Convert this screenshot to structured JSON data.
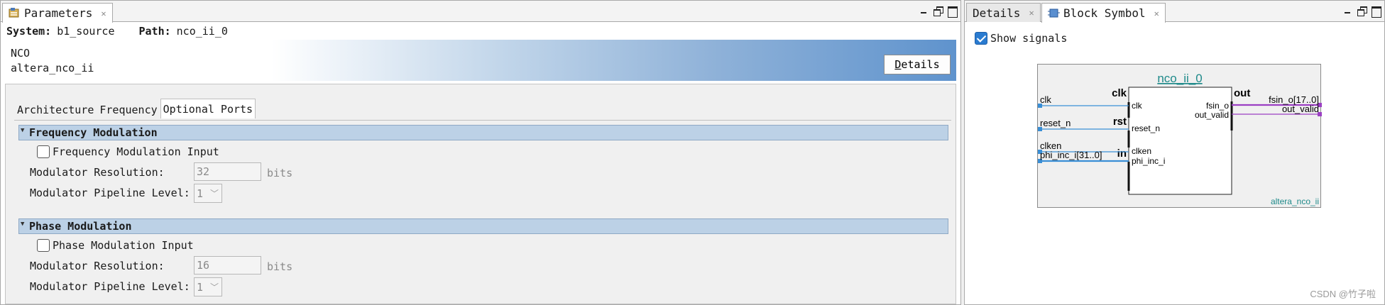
{
  "left_panel": {
    "tab_label": "Parameters",
    "path_bar": {
      "system_label": "System:",
      "system_value": "b1_source",
      "path_label": "Path:",
      "path_value": "nco_ii_0"
    },
    "header": {
      "title": "NCO",
      "subtitle": "altera_nco_ii",
      "details_button": "Details"
    },
    "subtabs": [
      "Architecture",
      "Frequency",
      "Optional Ports"
    ],
    "active_subtab": "Optional Ports",
    "groups": [
      {
        "title": "Frequency Modulation",
        "checkbox_label": "Frequency Modulation Input",
        "resolution_label": "Modulator Resolution:",
        "resolution_value": "32",
        "resolution_unit": "bits",
        "pipeline_label": "Modulator Pipeline Level:",
        "pipeline_value": "1"
      },
      {
        "title": "Phase Modulation",
        "checkbox_label": "Phase Modulation Input",
        "resolution_label": "Modulator Resolution:",
        "resolution_value": "16",
        "resolution_unit": "bits",
        "pipeline_label": "Modulator Pipeline Level:",
        "pipeline_value": "1"
      }
    ]
  },
  "right_panel": {
    "tabs": [
      "Details",
      "Block Symbol"
    ],
    "active_tab": "Block Symbol",
    "show_signals_label": "Show signals",
    "show_signals_checked": true,
    "symbol": {
      "instance_name": "nco_ii_0",
      "component_name": "altera_nco_ii",
      "interfaces": {
        "clk": "clk",
        "rst": "rst",
        "in": "in",
        "out": "out"
      },
      "left_ports": [
        "clk",
        "reset_n",
        "clken",
        "phi_inc_i"
      ],
      "left_signals": [
        "clk",
        "reset_n",
        "clken",
        "phi_inc_i[31..0]"
      ],
      "right_ports": [
        "fsin_o",
        "out_valid"
      ],
      "right_signals": [
        "fsin_o[17..0]",
        "out_valid"
      ]
    }
  },
  "watermark": "CSDN @竹子啦",
  "colors": {
    "signal_blue": "#3a8fd6",
    "signal_purple": "#9b3fc4",
    "title_teal": "#1f8a8a"
  }
}
